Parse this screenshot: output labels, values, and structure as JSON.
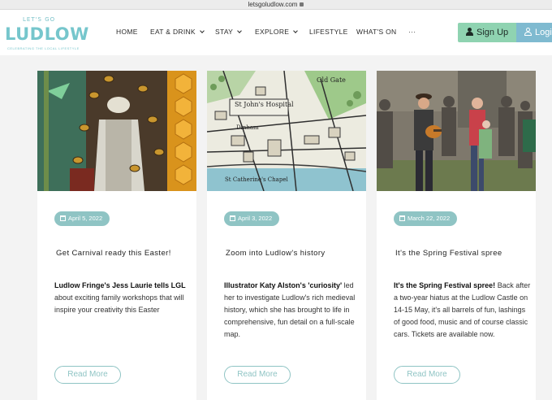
{
  "browser": {
    "url": "letsgoludlow.com"
  },
  "logo": {
    "small": "LET'S GO",
    "main": "LUDLOW",
    "tagline": "CELEBRATING THE LOCAL LIFESTYLE"
  },
  "nav": {
    "home": "HOME",
    "eat": "EAT & DRINK",
    "stay": "STAY",
    "explore": "EXPLORE",
    "lifestyle": "LIFESTYLE",
    "whats_on": "WHAT'S ON",
    "more": "···"
  },
  "auth": {
    "signup": "Sign Up",
    "login": "Login"
  },
  "colors": {
    "accent": "#8fc4c4",
    "signup_bg": "#8fd3b1",
    "login_bg": "#7fbad0"
  },
  "cards": [
    {
      "date": "April 5, 2022",
      "title": "Get Carnival ready this Easter!",
      "lead": "Ludlow Fringe's Jess Laurie tells LGL",
      "text": " about exciting family workshops that will inspire your creativity this Easter",
      "button": "Read More",
      "image": "bee-costume-carnival-photo"
    },
    {
      "date": "April 3, 2022",
      "title": "Zoom into Ludlow's history",
      "lead": "Illustrator Katy Alston's 'curiosity'",
      "text": " led her to investigate Ludlow's rich medieval history, which she has brought to life in comprehensive, fun detail on a full-scale map.",
      "button": "Read More",
      "image": "illustrated-map-st-johns-hospital",
      "map_labels": [
        "St John's Hospital",
        "Old Gate",
        "Dinham",
        "St Catherine's Chapel"
      ]
    },
    {
      "date": "March 22, 2022",
      "title": "It's the Spring Festival spree",
      "lead": "It's the Spring Festival spree!",
      "text": " Back after a two-year hiatus at the Ludlow Castle on 14-15 May, it's all barrels of fun, lashings of good food, music and of course classic cars. Tickets are available now.",
      "button": "Read More",
      "image": "festival-crowd-guitarist-photo"
    }
  ]
}
